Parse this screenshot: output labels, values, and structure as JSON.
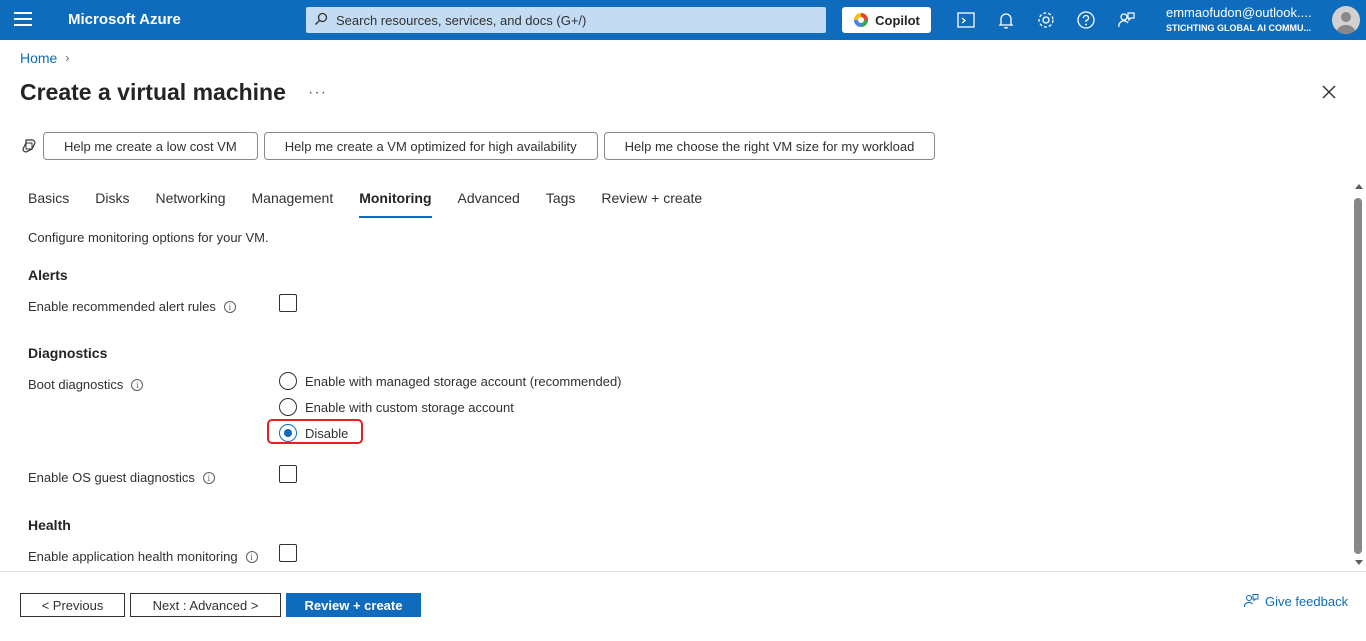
{
  "topbar": {
    "brand": "Microsoft Azure",
    "search_placeholder": "Search resources, services, and docs (G+/)",
    "copilot_label": "Copilot",
    "user_email": "emmaofudon@outlook....",
    "user_org": "STICHTING GLOBAL AI COMMU..."
  },
  "breadcrumb": {
    "home": "Home"
  },
  "page": {
    "title": "Create a virtual machine",
    "more": "···"
  },
  "copilot_suggestions": [
    "Help me create a low cost VM",
    "Help me create a VM optimized for high availability",
    "Help me choose the right VM size for my workload"
  ],
  "tabs": [
    "Basics",
    "Disks",
    "Networking",
    "Management",
    "Monitoring",
    "Advanced",
    "Tags",
    "Review + create"
  ],
  "active_tab": "Monitoring",
  "content": {
    "description": "Configure monitoring options for your VM.",
    "alerts": {
      "heading": "Alerts",
      "recommended_alert_rules_label": "Enable recommended alert rules",
      "recommended_alert_rules_checked": false
    },
    "diagnostics": {
      "heading": "Diagnostics",
      "boot_label": "Boot diagnostics",
      "boot_options": [
        "Enable with managed storage account (recommended)",
        "Enable with custom storage account",
        "Disable"
      ],
      "boot_selected": "Disable",
      "os_guest_label": "Enable OS guest diagnostics",
      "os_guest_checked": false
    },
    "health": {
      "heading": "Health",
      "app_health_label": "Enable application health monitoring",
      "app_health_checked": false
    }
  },
  "footer": {
    "previous": "< Previous",
    "next": "Next : Advanced >",
    "review_create": "Review + create",
    "feedback": "Give feedback"
  },
  "colors": {
    "accent": "#0f6cbd",
    "highlight": "#e5201f"
  }
}
